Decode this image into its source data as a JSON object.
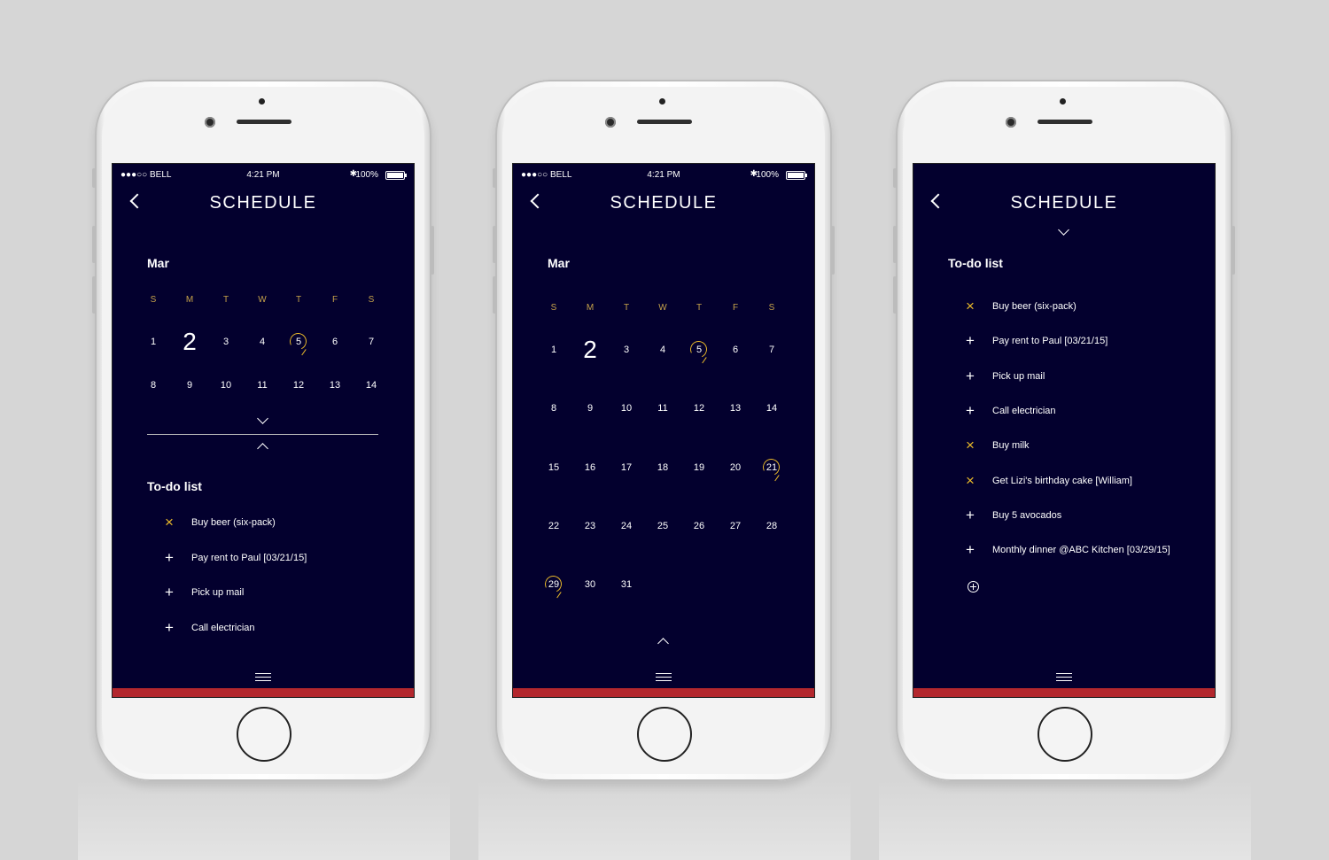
{
  "status": {
    "carrier": "●●●○○ BELL",
    "time": "4:21 PM",
    "battery": "100%",
    "bluetooth": "✱"
  },
  "screen_title": "SCHEDULE",
  "month": "Mar",
  "weekdays": [
    "S",
    "M",
    "T",
    "W",
    "T",
    "F",
    "S"
  ],
  "todo_title": "To-do list",
  "phone1": {
    "days": [
      "1",
      "2",
      "3",
      "4",
      "5",
      "6",
      "7",
      "8",
      "9",
      "10",
      "11",
      "12",
      "13",
      "14"
    ],
    "todos": [
      {
        "icon": "x",
        "label": "Buy beer (six-pack)"
      },
      {
        "icon": "+",
        "label": "Pay rent to Paul [03/21/15]"
      },
      {
        "icon": "+",
        "label": "Pick up mail"
      },
      {
        "icon": "+",
        "label": "Call electrician"
      }
    ]
  },
  "phone2": {
    "days": [
      "1",
      "2",
      "3",
      "4",
      "5",
      "6",
      "7",
      "8",
      "9",
      "10",
      "11",
      "12",
      "13",
      "14",
      "15",
      "16",
      "17",
      "18",
      "19",
      "20",
      "21",
      "22",
      "23",
      "24",
      "25",
      "26",
      "27",
      "28",
      "29",
      "30",
      "31"
    ]
  },
  "phone3": {
    "todos": [
      {
        "icon": "x",
        "label": "Buy beer (six-pack)"
      },
      {
        "icon": "+",
        "label": "Pay rent to Paul [03/21/15]"
      },
      {
        "icon": "+",
        "label": "Pick up mail"
      },
      {
        "icon": "+",
        "label": "Call electrician"
      },
      {
        "icon": "x",
        "label": "Buy milk"
      },
      {
        "icon": "x",
        "label": "Get Lizi's birthday cake [William]"
      },
      {
        "icon": "+",
        "label": "Buy 5 avocados"
      },
      {
        "icon": "+",
        "label": "Monthly dinner @ABC Kitchen [03/29/15]"
      }
    ]
  },
  "marked_days": [
    "5",
    "21",
    "29"
  ],
  "today": "2",
  "colors": {
    "screen_bg": "#03002e",
    "accent": "#e9b92a",
    "footer": "#b3272d"
  }
}
